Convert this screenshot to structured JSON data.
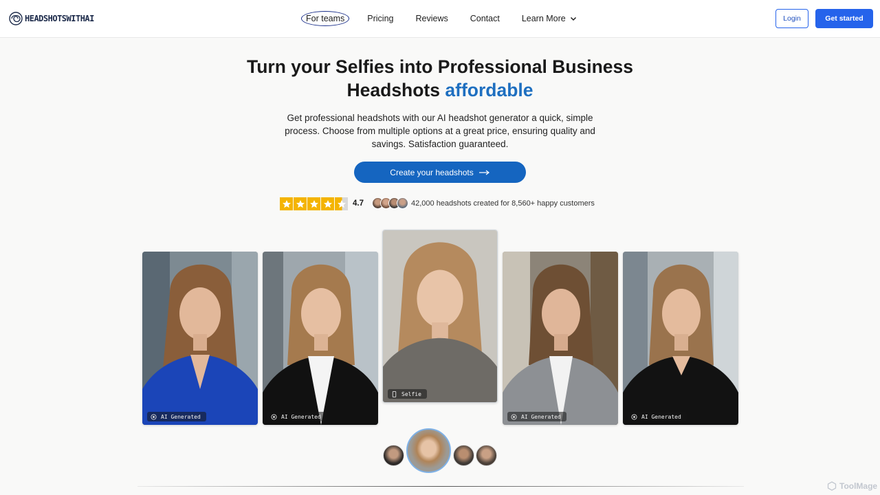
{
  "brand": {
    "name": "HEADSHOTSWITHAI"
  },
  "nav": {
    "items": [
      {
        "label": "For teams"
      },
      {
        "label": "Pricing"
      },
      {
        "label": "Reviews"
      },
      {
        "label": "Contact"
      },
      {
        "label": "Learn More"
      }
    ],
    "login_label": "Login",
    "get_started_label": "Get started"
  },
  "hero": {
    "title_line1": "Turn your Selfies into Professional Business",
    "title_line2": "Headshots",
    "title_accent": "affordable",
    "subtitle": "Get professional headshots with our AI headshot generator a quick, simple process. Choose from multiple options at a great price, ensuring quality and savings. Satisfaction guaranteed.",
    "cta_label": "Create your headshots"
  },
  "social_proof": {
    "rating": "4.7",
    "stars": 4.5,
    "text": "42,000 headshots created for 8,560+ happy customers"
  },
  "gallery": {
    "cards": [
      {
        "tag": "AI Generated",
        "outfit": "blue blazer"
      },
      {
        "tag": "AI Generated",
        "outfit": "black blazer, white shirt"
      },
      {
        "tag": "Selfie",
        "outfit": "grey sweater"
      },
      {
        "tag": "AI Generated",
        "outfit": "grey blazer"
      },
      {
        "tag": "AI Generated",
        "outfit": "black blouse"
      }
    ]
  },
  "watermark": "ToolMage",
  "colors": {
    "accent": "#1e6fc0",
    "primary_button": "#2563eb",
    "cta": "#1565c0",
    "star": "#f4b400"
  }
}
